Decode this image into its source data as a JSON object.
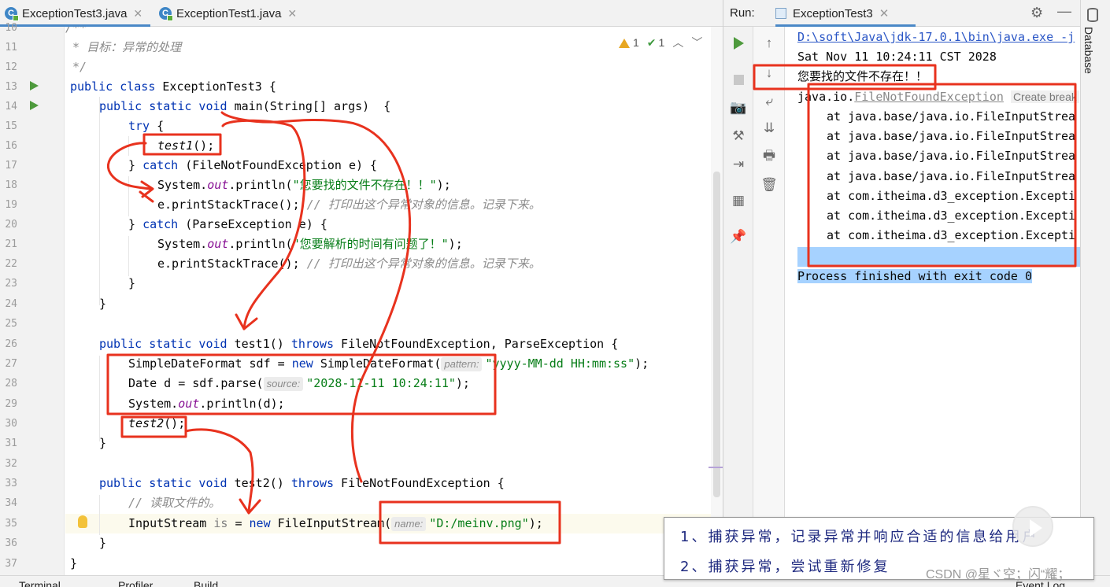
{
  "editor": {
    "tabs": [
      {
        "label": "ExceptionTest3.java",
        "icon": "C",
        "active": true
      },
      {
        "label": "ExceptionTest1.java",
        "icon": "C",
        "active": false
      }
    ],
    "inspections": {
      "warnings": "1",
      "ok": "1"
    },
    "line_numbers": [
      "10",
      "11",
      "12",
      "13",
      "14",
      "15",
      "16",
      "17",
      "18",
      "19",
      "20",
      "21",
      "22",
      "23",
      "24",
      "25",
      "26",
      "27",
      "28",
      "29",
      "30",
      "31",
      "32",
      "33",
      "34",
      "35",
      "36",
      "37"
    ],
    "code": {
      "l10": "/**",
      "l11": " * 目标：异常的处理",
      "l12": " */",
      "l13_kw": "public class",
      "l13_rest": " ExceptionTest3 {",
      "l14_kw": "public static void",
      "l14_rest": " main(String[] args)  {",
      "l15_kw": "try",
      "l15_rest": " {",
      "l16": "test1",
      "l16_rest": "();",
      "l17_a": "} ",
      "l17_kw": "catch",
      "l17_rest": " (FileNotFoundException e) {",
      "l18_a": "System.",
      "l18_fld": "out",
      "l18_b": ".println(",
      "l18_str": "\"您要找的文件不存在！！\"",
      "l18_c": ");",
      "l19_a": "e.printStackTrace(); ",
      "l19_cm": "// 打印出这个异常对象的信息。记录下来。",
      "l20_a": "} ",
      "l20_kw": "catch",
      "l20_rest": " (ParseException e) {",
      "l21_a": "System.",
      "l21_fld": "out",
      "l21_b": ".println(",
      "l21_str": "\"您要解析的时间有问题了！\"",
      "l21_c": ");",
      "l22_a": "e.printStackTrace(); ",
      "l22_cm": "// 打印出这个异常对象的信息。记录下来。",
      "l23": "}",
      "l24": "}",
      "l26_kw": "public static void",
      "l26_a": " test1() ",
      "l26_kw2": "throws",
      "l26_rest": " FileNotFoundException, ParseException {",
      "l27_a": "SimpleDateFormat sdf = ",
      "l27_kw": "new",
      "l27_b": " SimpleDateFormat(",
      "l27_hint": "pattern:",
      "l27_str": "\"yyyy-MM-dd HH:mm:ss\"",
      "l27_c": ");",
      "l28_a": "Date d = sdf.parse(",
      "l28_hint": "source:",
      "l28_str": "\"2028-11-11 10:24:11\"",
      "l28_c": ");",
      "l29_a": "System.",
      "l29_fld": "out",
      "l29_b": ".println(d);",
      "l30": "test2",
      "l30_rest": "();",
      "l31": "}",
      "l33_kw": "public static void",
      "l33_a": " test2() ",
      "l33_kw2": "throws",
      "l33_rest": " FileNotFoundException {",
      "l34": "// 读取文件的。",
      "l35_a": "InputStream ",
      "l35_var": "is",
      "l35_b": " = ",
      "l35_kw": "new",
      "l35_c": " FileInputStream(",
      "l35_hint": "name:",
      "l35_str": "\"D:/meinv.png\"",
      "l35_d": ");",
      "l36": "}",
      "l37": "}"
    }
  },
  "run": {
    "label": "Run:",
    "tab": "ExceptionTest3",
    "console": {
      "cmd": "D:\\soft\\Java\\jdk-17.0.1\\bin\\java.exe -j",
      "date": "Sat Nov 11 10:24:11 CST 2028",
      "message": "您要找的文件不存在！！",
      "exc_prefix": "java.io.",
      "exc_name": "FileNotFoundException",
      "exc_action": "Create break",
      "stack": [
        "at java.base/java.io.FileInputStrea",
        "at java.base/java.io.FileInputStrea",
        "at java.base/java.io.FileInputStrea",
        "at java.base/java.io.FileInputStrea",
        "at com.itheima.d3_exception.Excepti",
        "at com.itheima.d3_exception.Excepti",
        "at com.itheima.d3_exception.Excepti"
      ],
      "exit": "Process finished with exit code 0"
    }
  },
  "right_strip": {
    "label": "Database"
  },
  "bottom_bar": {
    "items": [
      "Terminal",
      "Profiler",
      "Build",
      "Event Log"
    ]
  },
  "note": {
    "line1": "1、捕获异常，记录异常并响应合适的信息给用户",
    "line2": "2、捕获异常，尝试重新修复"
  },
  "watermark": "CSDN @星ヾ空；闪“耀；",
  "colors": {
    "annotation": "#e8321e",
    "keyword": "#0033b3",
    "string": "#067d17",
    "comment": "#8c8c8c"
  }
}
